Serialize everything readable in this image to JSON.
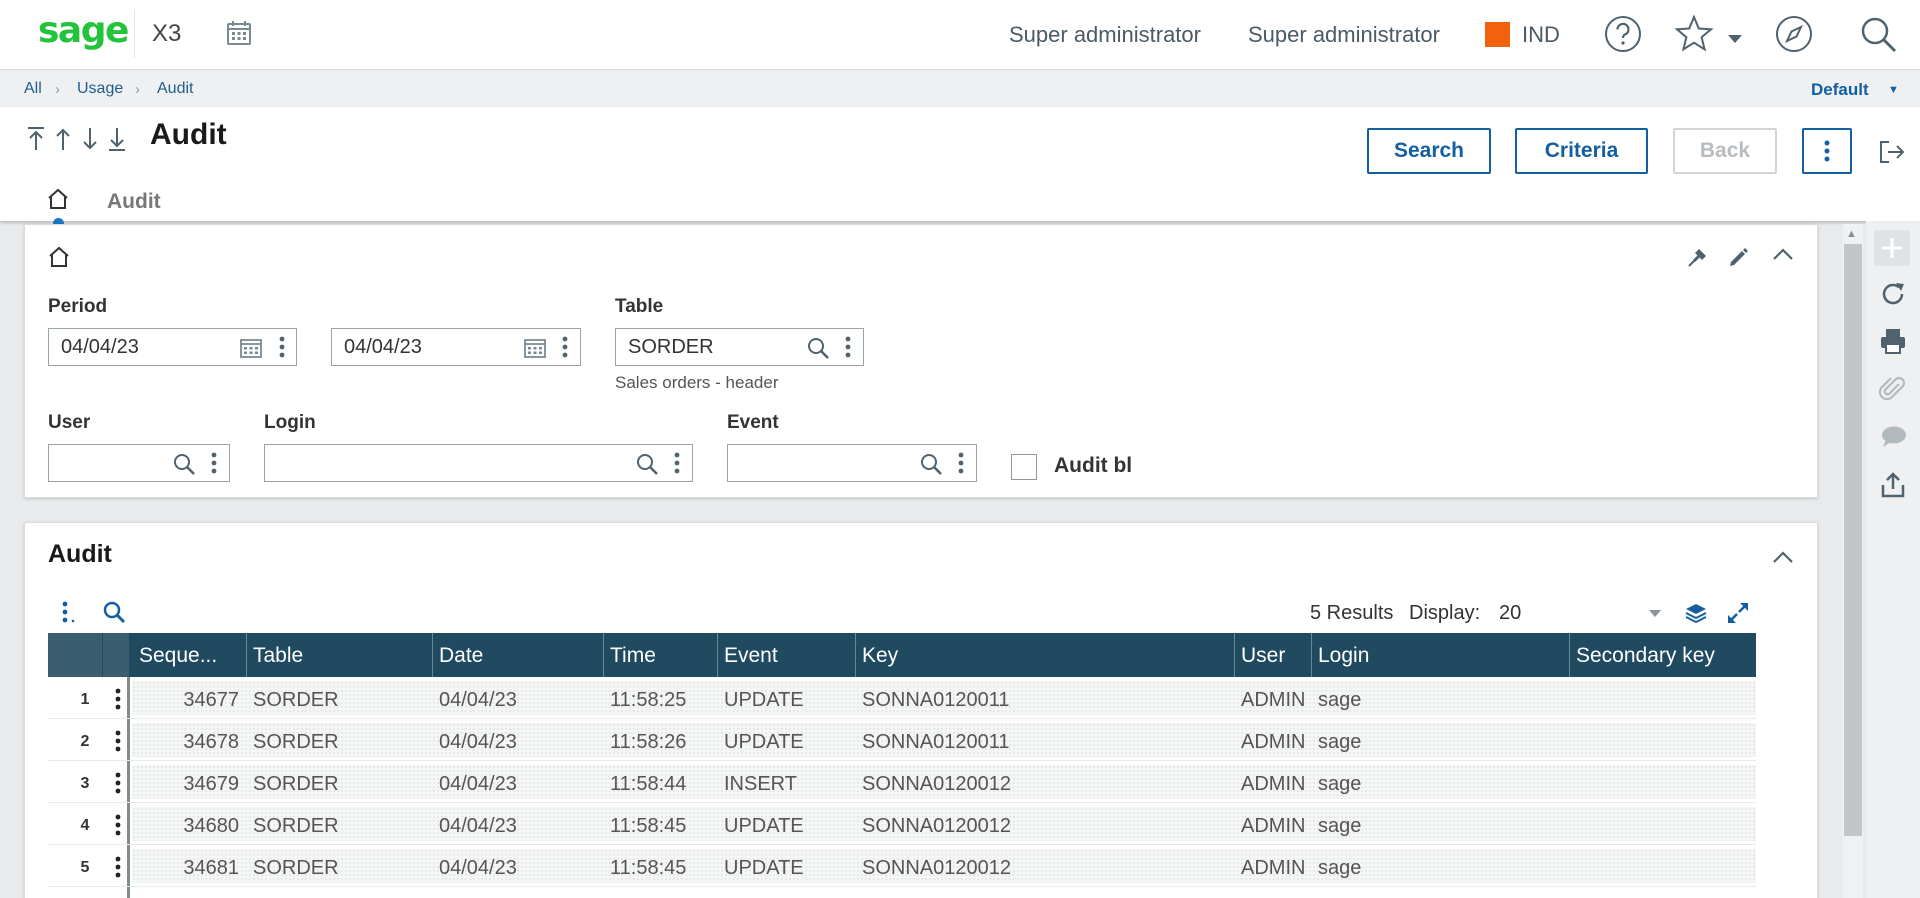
{
  "app": {
    "logo": "sage",
    "product": "X3",
    "user1": "Super administrator",
    "user2": "Super administrator",
    "company_code": "IND",
    "company_color": "#f0620c"
  },
  "breadcrumb": {
    "items": [
      "All",
      "Usage",
      "Audit"
    ],
    "default_label": "Default"
  },
  "header": {
    "title": "Audit",
    "buttons": {
      "search": "Search",
      "criteria": "Criteria",
      "back": "Back"
    },
    "tab_label": "Audit"
  },
  "criteria": {
    "period_label": "Period",
    "period_from": "04/04/23",
    "period_to": "04/04/23",
    "table_label": "Table",
    "table_value": "SORDER",
    "table_description": "Sales orders - header",
    "user_label": "User",
    "user_value": "",
    "login_label": "Login",
    "login_value": "",
    "event_label": "Event",
    "event_value": "",
    "audit_bl_label": "Audit bl",
    "audit_bl_checked": false
  },
  "grid": {
    "title": "Audit",
    "results": "5 Results",
    "display_label": "Display:",
    "display_value": "20",
    "columns": [
      "Seque...",
      "Table",
      "Date",
      "Time",
      "Event",
      "Key",
      "User",
      "Login",
      "Secondary key"
    ],
    "rows": [
      {
        "num": "1",
        "seq": "34677",
        "table": "SORDER",
        "date": "04/04/23",
        "time": "11:58:25",
        "event": "UPDATE",
        "key": "SONNA0120011",
        "user": "ADMIN",
        "login": "sage",
        "secondary": ""
      },
      {
        "num": "2",
        "seq": "34678",
        "table": "SORDER",
        "date": "04/04/23",
        "time": "11:58:26",
        "event": "UPDATE",
        "key": "SONNA0120011",
        "user": "ADMIN",
        "login": "sage",
        "secondary": ""
      },
      {
        "num": "3",
        "seq": "34679",
        "table": "SORDER",
        "date": "04/04/23",
        "time": "11:58:44",
        "event": "INSERT",
        "key": "SONNA0120012",
        "user": "ADMIN",
        "login": "sage",
        "secondary": ""
      },
      {
        "num": "4",
        "seq": "34680",
        "table": "SORDER",
        "date": "04/04/23",
        "time": "11:58:45",
        "event": "UPDATE",
        "key": "SONNA0120012",
        "user": "ADMIN",
        "login": "sage",
        "secondary": ""
      },
      {
        "num": "5",
        "seq": "34681",
        "table": "SORDER",
        "date": "04/04/23",
        "time": "11:58:45",
        "event": "UPDATE",
        "key": "SONNA0120012",
        "user": "ADMIN",
        "login": "sage",
        "secondary": ""
      }
    ]
  },
  "colors": {
    "accent": "#145fa0",
    "brand_green": "#23c33b",
    "grid_header": "#1f4a60"
  },
  "icons": {
    "top": [
      "calendar-icon",
      "help-icon",
      "star-icon",
      "compass-icon",
      "search-icon"
    ],
    "side": [
      "plus-icon",
      "refresh-icon",
      "print-icon",
      "attachment-icon",
      "comment-icon",
      "export-icon"
    ]
  }
}
